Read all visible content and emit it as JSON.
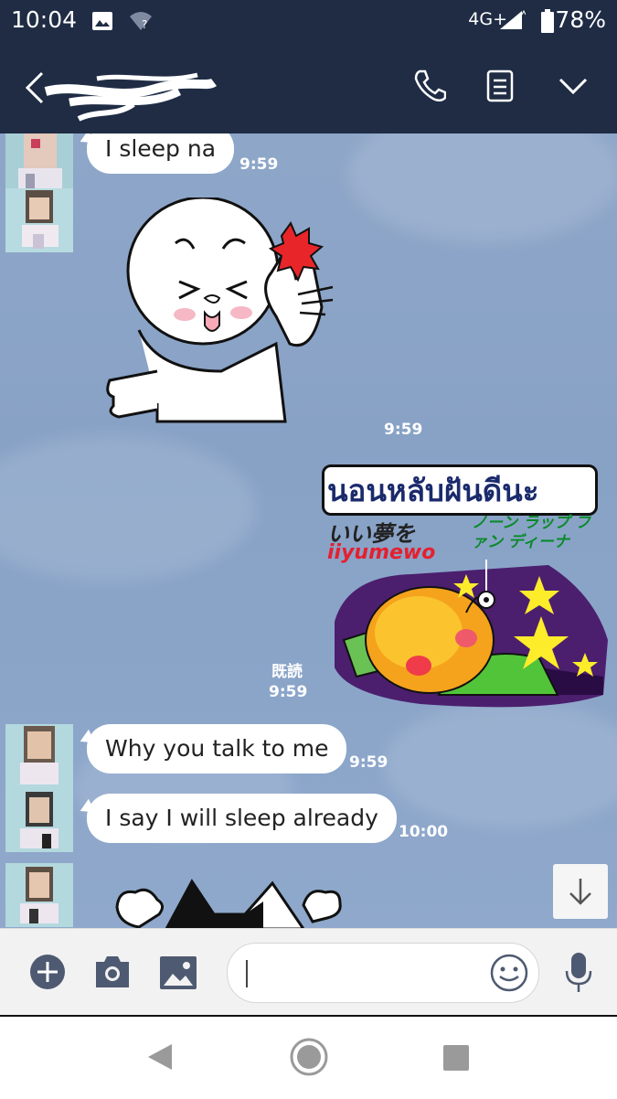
{
  "status_bar": {
    "time": "10:04",
    "network": "4G+",
    "battery": "78%"
  },
  "header": {
    "contact_name": "",
    "icons": [
      "back-chevron-icon",
      "phone-icon",
      "notes-icon",
      "chevron-down-icon"
    ]
  },
  "messages": [
    {
      "type": "text",
      "side": "left",
      "text": "I sleep na",
      "time": "9:59"
    },
    {
      "type": "sticker",
      "side": "left",
      "description_icon": "face-sticker",
      "time": "9:59"
    },
    {
      "type": "sticker",
      "side": "right",
      "sticker_text": {
        "thai": "นอนหลับฝันดีนะ",
        "jp": "いい夢を",
        "romaji": "iiyumewo",
        "kana": "ノーン ラップ ファン ディーナ"
      },
      "read": "既読",
      "time": "9:59"
    },
    {
      "type": "text",
      "side": "left",
      "text": "Why you talk to me",
      "time": "9:59"
    },
    {
      "type": "text",
      "side": "left",
      "text": "I say I will sleep already",
      "time": "10:00"
    }
  ],
  "input": {
    "placeholder": ""
  },
  "colors": {
    "header": "#1f2c44",
    "chat_bg": "#8ca6c9",
    "bubble": "#ffffff",
    "timestamp": "#ffffff"
  }
}
